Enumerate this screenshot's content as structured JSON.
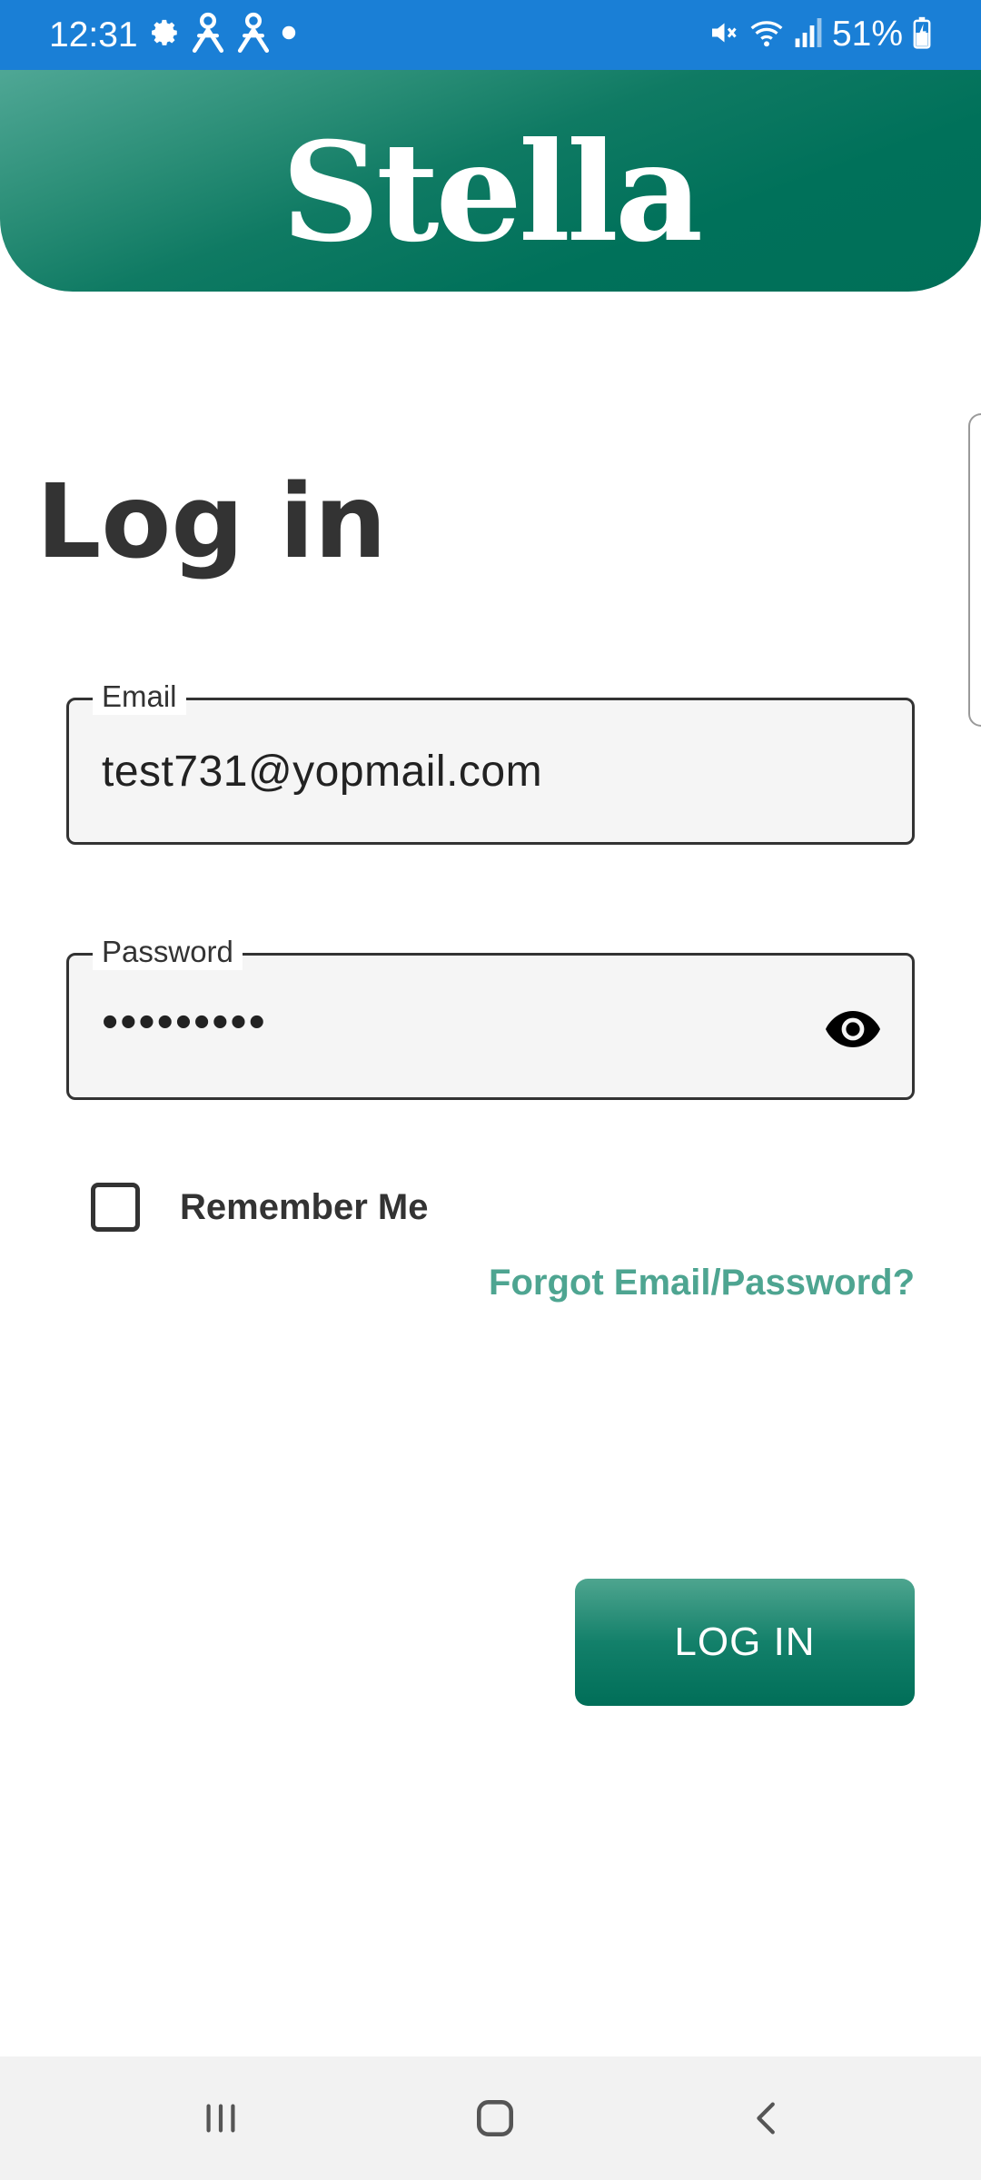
{
  "status_bar": {
    "time": "12:31",
    "battery": "51%",
    "icons": [
      "gear-icon",
      "accessibility-person-icon",
      "accessibility-person-icon",
      "dot-icon",
      "mute-icon",
      "wifi-icon",
      "signal-icon",
      "battery-charging-icon"
    ]
  },
  "header": {
    "brand": "Stella",
    "gradient_start": "#4fa795",
    "gradient_end": "#006f58"
  },
  "page": {
    "title": "Log in"
  },
  "form": {
    "email": {
      "label": "Email",
      "value": "test731@yopmail.com"
    },
    "password": {
      "label": "Password",
      "value": "•••••••••",
      "toggle_icon": "eye-icon"
    },
    "remember_me": {
      "label": "Remember Me",
      "checked": false
    },
    "forgot_link": "Forgot Email/Password?",
    "submit_label": "LOG IN"
  },
  "colors": {
    "accent": "#4ea591",
    "button": "#13806a",
    "text": "#333333",
    "status_bar": "#1a7fd6"
  },
  "nav_bar": {
    "buttons": [
      "recents-icon",
      "home-icon",
      "back-icon"
    ]
  }
}
